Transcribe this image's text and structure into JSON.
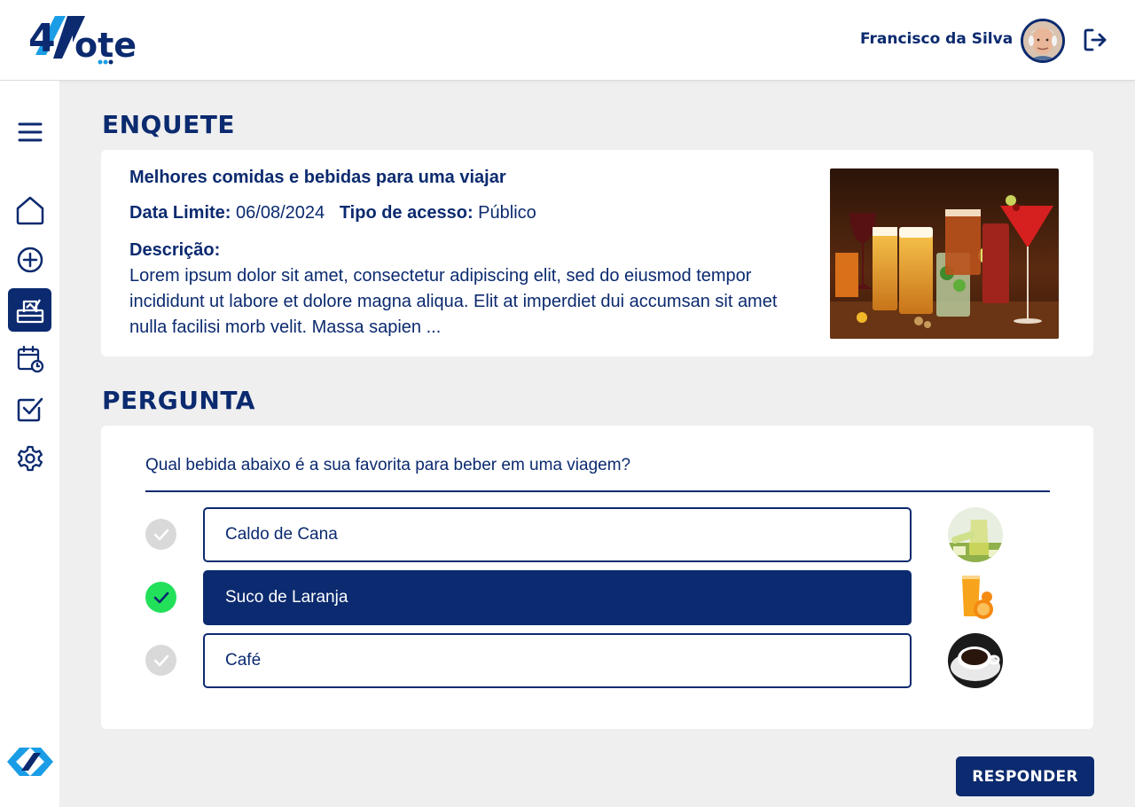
{
  "app": {
    "logo_text": "4Vote",
    "icons": [
      "logo",
      "user-avatar",
      "logout-icon"
    ]
  },
  "header": {
    "user_name": "Francisco da Silva"
  },
  "sidebar": {
    "items": [
      {
        "icon": "menu-icon",
        "active": false
      },
      {
        "icon": "home-icon",
        "active": false
      },
      {
        "icon": "add-circle-icon",
        "active": false
      },
      {
        "icon": "ballot-box-icon",
        "active": true
      },
      {
        "icon": "calendar-clock-icon",
        "active": false
      },
      {
        "icon": "checkbox-icon",
        "active": false
      },
      {
        "icon": "gear-icon",
        "active": false
      }
    ]
  },
  "poll": {
    "section_title": "ENQUETE",
    "title": "Melhores comidas e bebidas para uma viajar",
    "deadline_label": "Data Limite:",
    "deadline_value": "06/08/2024",
    "access_label": "Tipo de acesso:",
    "access_value": "Público",
    "description_label": "Descrição:",
    "description": "Lorem ipsum dolor sit amet, consectetur adipiscing elit, sed do eiusmod tempor incididunt ut labore et dolore magna aliqua. Elit at imperdiet dui accumsan sit amet nulla facilisi morb velit. Massa sapien ..."
  },
  "question": {
    "section_title": "PERGUNTA",
    "text": "Qual bebida abaixo é a sua favorita para beber em uma viagem?",
    "options": [
      {
        "label": "Caldo de Cana",
        "selected": false
      },
      {
        "label": "Suco de Laranja",
        "selected": true
      },
      {
        "label": "Café",
        "selected": false
      }
    ]
  },
  "actions": {
    "respond_label": "RESPONDER"
  },
  "colors": {
    "primary": "#0b2a6f",
    "accent_green": "#22e05a",
    "background": "#efefef"
  }
}
